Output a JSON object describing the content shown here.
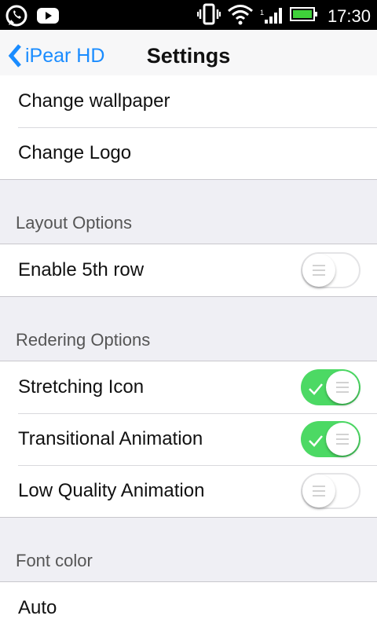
{
  "status_bar": {
    "time": "17:30",
    "icons": [
      "whatsapp-icon",
      "youtube-icon",
      "vibrate-icon",
      "wifi-icon",
      "signal-icon",
      "battery-icon"
    ]
  },
  "nav": {
    "back_label": "iPear HD",
    "title": "Settings"
  },
  "groups": [
    {
      "items": [
        {
          "label": "Change wallpaper"
        },
        {
          "label": "Change Logo"
        }
      ]
    }
  ],
  "sections": [
    {
      "header": "Layout Options",
      "items": [
        {
          "label": "Enable 5th row",
          "toggle": false
        }
      ]
    },
    {
      "header": "Redering Options",
      "items": [
        {
          "label": "Stretching Icon",
          "toggle": true
        },
        {
          "label": "Transitional Animation",
          "toggle": true
        },
        {
          "label": "Low Quality Animation",
          "toggle": false
        }
      ]
    },
    {
      "header": "Font color",
      "items": [
        {
          "label": "Auto"
        }
      ]
    }
  ],
  "colors": {
    "accent": "#1a8cff",
    "toggle_on": "#4cd964",
    "background": "#efeff4"
  }
}
